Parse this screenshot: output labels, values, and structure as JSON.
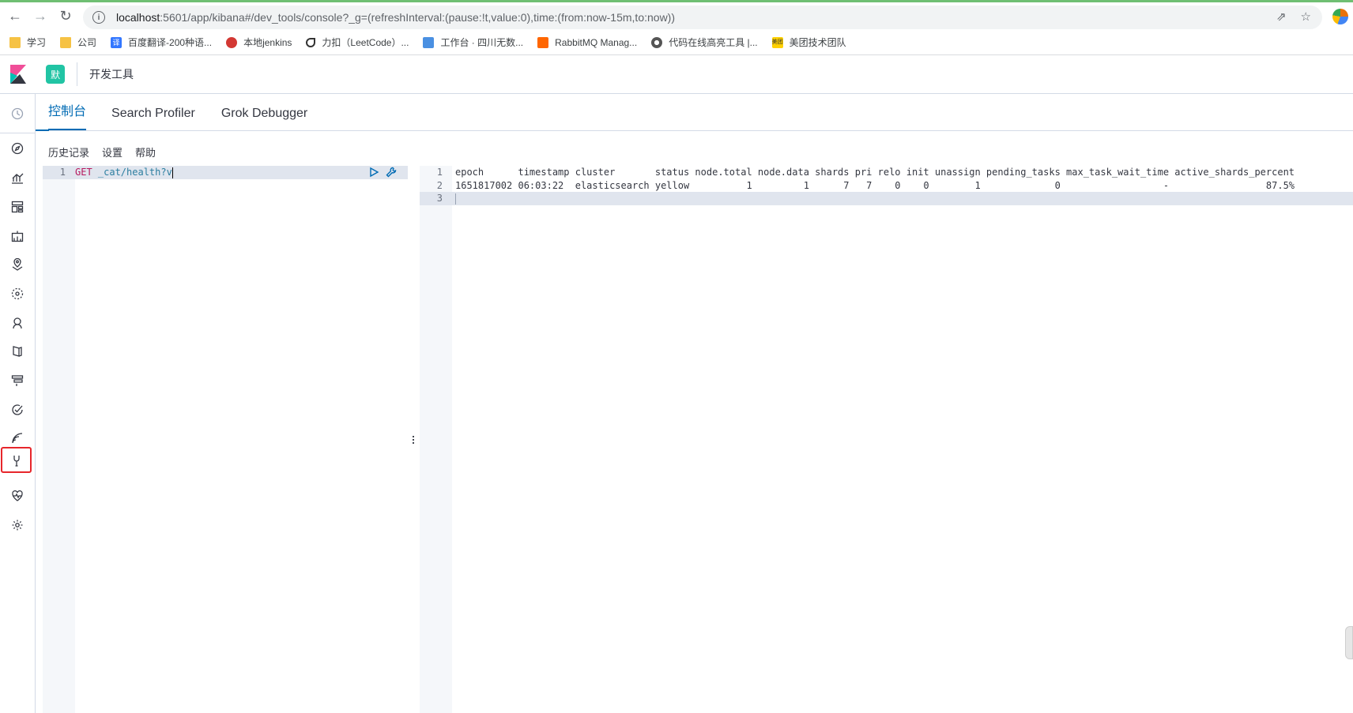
{
  "browser": {
    "url_host": "localhost",
    "url_rest": ":5601/app/kibana#/dev_tools/console?_g=(refreshInterval:(pause:!t,value:0),time:(from:now-15m,to:now))",
    "bookmarks": [
      {
        "label": "学习",
        "icon": "folder"
      },
      {
        "label": "公司",
        "icon": "folder"
      },
      {
        "label": "百度翻译-200种语...",
        "icon": "fanyi"
      },
      {
        "label": "本地jenkins",
        "icon": "jenkins"
      },
      {
        "label": "力扣（LeetCode）...",
        "icon": "leet"
      },
      {
        "label": "工作台 · 四川无数...",
        "icon": "work"
      },
      {
        "label": "RabbitMQ Manag...",
        "icon": "rabbit"
      },
      {
        "label": "代码在线高亮工具 |...",
        "icon": "code"
      },
      {
        "label": "美团技术团队",
        "icon": "meituan"
      }
    ],
    "bookmark_icon_text": {
      "fanyi": "译",
      "meituan": "美团"
    }
  },
  "header": {
    "space_badge": "默",
    "breadcrumb": "开发工具"
  },
  "tabs": [
    {
      "label": "控制台",
      "selected": true
    },
    {
      "label": "Search Profiler",
      "selected": false
    },
    {
      "label": "Grok Debugger",
      "selected": false
    }
  ],
  "submenu": {
    "history": "历史记录",
    "settings": "设置",
    "help": "帮助"
  },
  "request": {
    "line_numbers": [
      "1"
    ],
    "method": "GET",
    "path": " _cat/health?v"
  },
  "response": {
    "line_numbers": [
      "1",
      "2",
      "3"
    ],
    "header_row": "epoch      timestamp cluster       status node.total node.data shards pri relo init unassign pending_tasks max_task_wait_time active_shards_percent",
    "data_row": "1651817002 06:03:22  elasticsearch yellow          1         1      7   7    0    0        1             0                  -                 87.5%",
    "line3": ""
  },
  "sidenav": {
    "icons": [
      "recent-icon",
      "discover-icon",
      "visualize-icon",
      "dashboard-icon",
      "canvas-icon",
      "maps-icon",
      "ml-icon",
      "infrastructure-icon",
      "logs-icon",
      "apm-icon",
      "uptime-icon",
      "siem-icon",
      "dev-tools-icon",
      "monitoring-icon",
      "management-icon"
    ],
    "active": "dev-tools-icon"
  },
  "colors": {
    "accent": "#006bb4",
    "space_badge": "#21c4a4",
    "highlight_box": "#e7262b",
    "method": "#b7195e",
    "path": "#2c7ea0"
  }
}
